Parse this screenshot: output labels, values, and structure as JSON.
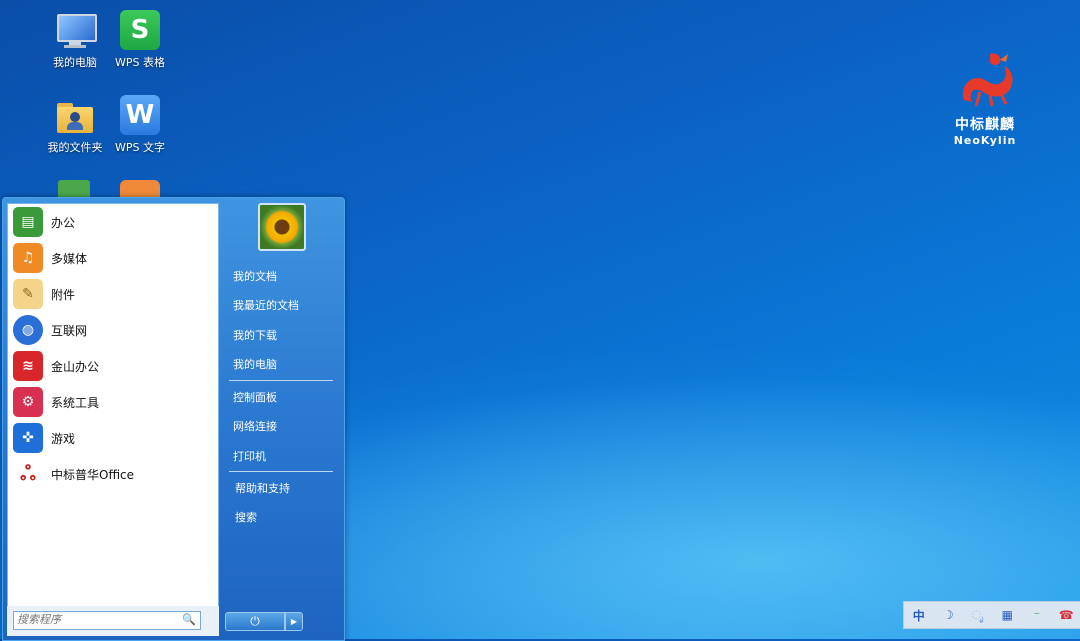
{
  "desktop": {
    "icons": [
      {
        "label": "我的电脑",
        "icon": "computer-icon"
      },
      {
        "label": "WPS 表格",
        "icon": "wps-spreadsheet-icon"
      },
      {
        "label": "我的文件夹",
        "icon": "folder-icon"
      },
      {
        "label": "WPS 文字",
        "icon": "wps-writer-icon"
      }
    ]
  },
  "logo": {
    "cn": "中标麒麟",
    "en": "NeoKylin"
  },
  "start_menu": {
    "apps": [
      {
        "label": "办公",
        "icon": "office-icon",
        "color": "#3a9a3a"
      },
      {
        "label": "多媒体",
        "icon": "multimedia-icon",
        "color": "#f08a24"
      },
      {
        "label": "附件",
        "icon": "accessories-icon",
        "color": "#e8c070"
      },
      {
        "label": "互联网",
        "icon": "internet-icon",
        "color": "#2a6ed8"
      },
      {
        "label": "金山办公",
        "icon": "kingsoft-icon",
        "color": "#d8262a"
      },
      {
        "label": "系统工具",
        "icon": "system-tools-icon",
        "color": "#d83050"
      },
      {
        "label": "游戏",
        "icon": "games-icon",
        "color": "#1f6fd8"
      },
      {
        "label": "中标普华Office",
        "icon": "cs2c-office-icon",
        "color": "#c82020"
      }
    ],
    "search_placeholder": "搜索程序",
    "places": [
      "我的文档",
      "我最近的文档",
      "我的下载",
      "我的电脑"
    ],
    "system": [
      "控制面板",
      "网络连接",
      "打印机"
    ],
    "help": [
      "帮助和支持",
      "搜索"
    ],
    "power_label": "⏻"
  },
  "tray": {
    "items": [
      {
        "glyph": "中",
        "icon": "input-method-icon",
        "color": "#2a5cc0"
      },
      {
        "glyph": "☽",
        "icon": "moon-icon",
        "color": "#2a5cc0"
      },
      {
        "glyph": "ೃ",
        "icon": "punctuation-icon",
        "color": "#2a5cc0"
      },
      {
        "glyph": "▦",
        "icon": "keyboard-icon",
        "color": "#2a5cc0"
      },
      {
        "glyph": "⁻",
        "icon": "tools-icon",
        "color": "#2a9a3a"
      },
      {
        "glyph": "☎",
        "icon": "phone-icon",
        "color": "#d8303a"
      }
    ]
  },
  "colors": {
    "desktop": "#0b62c4",
    "menu": "#2a78d0"
  }
}
